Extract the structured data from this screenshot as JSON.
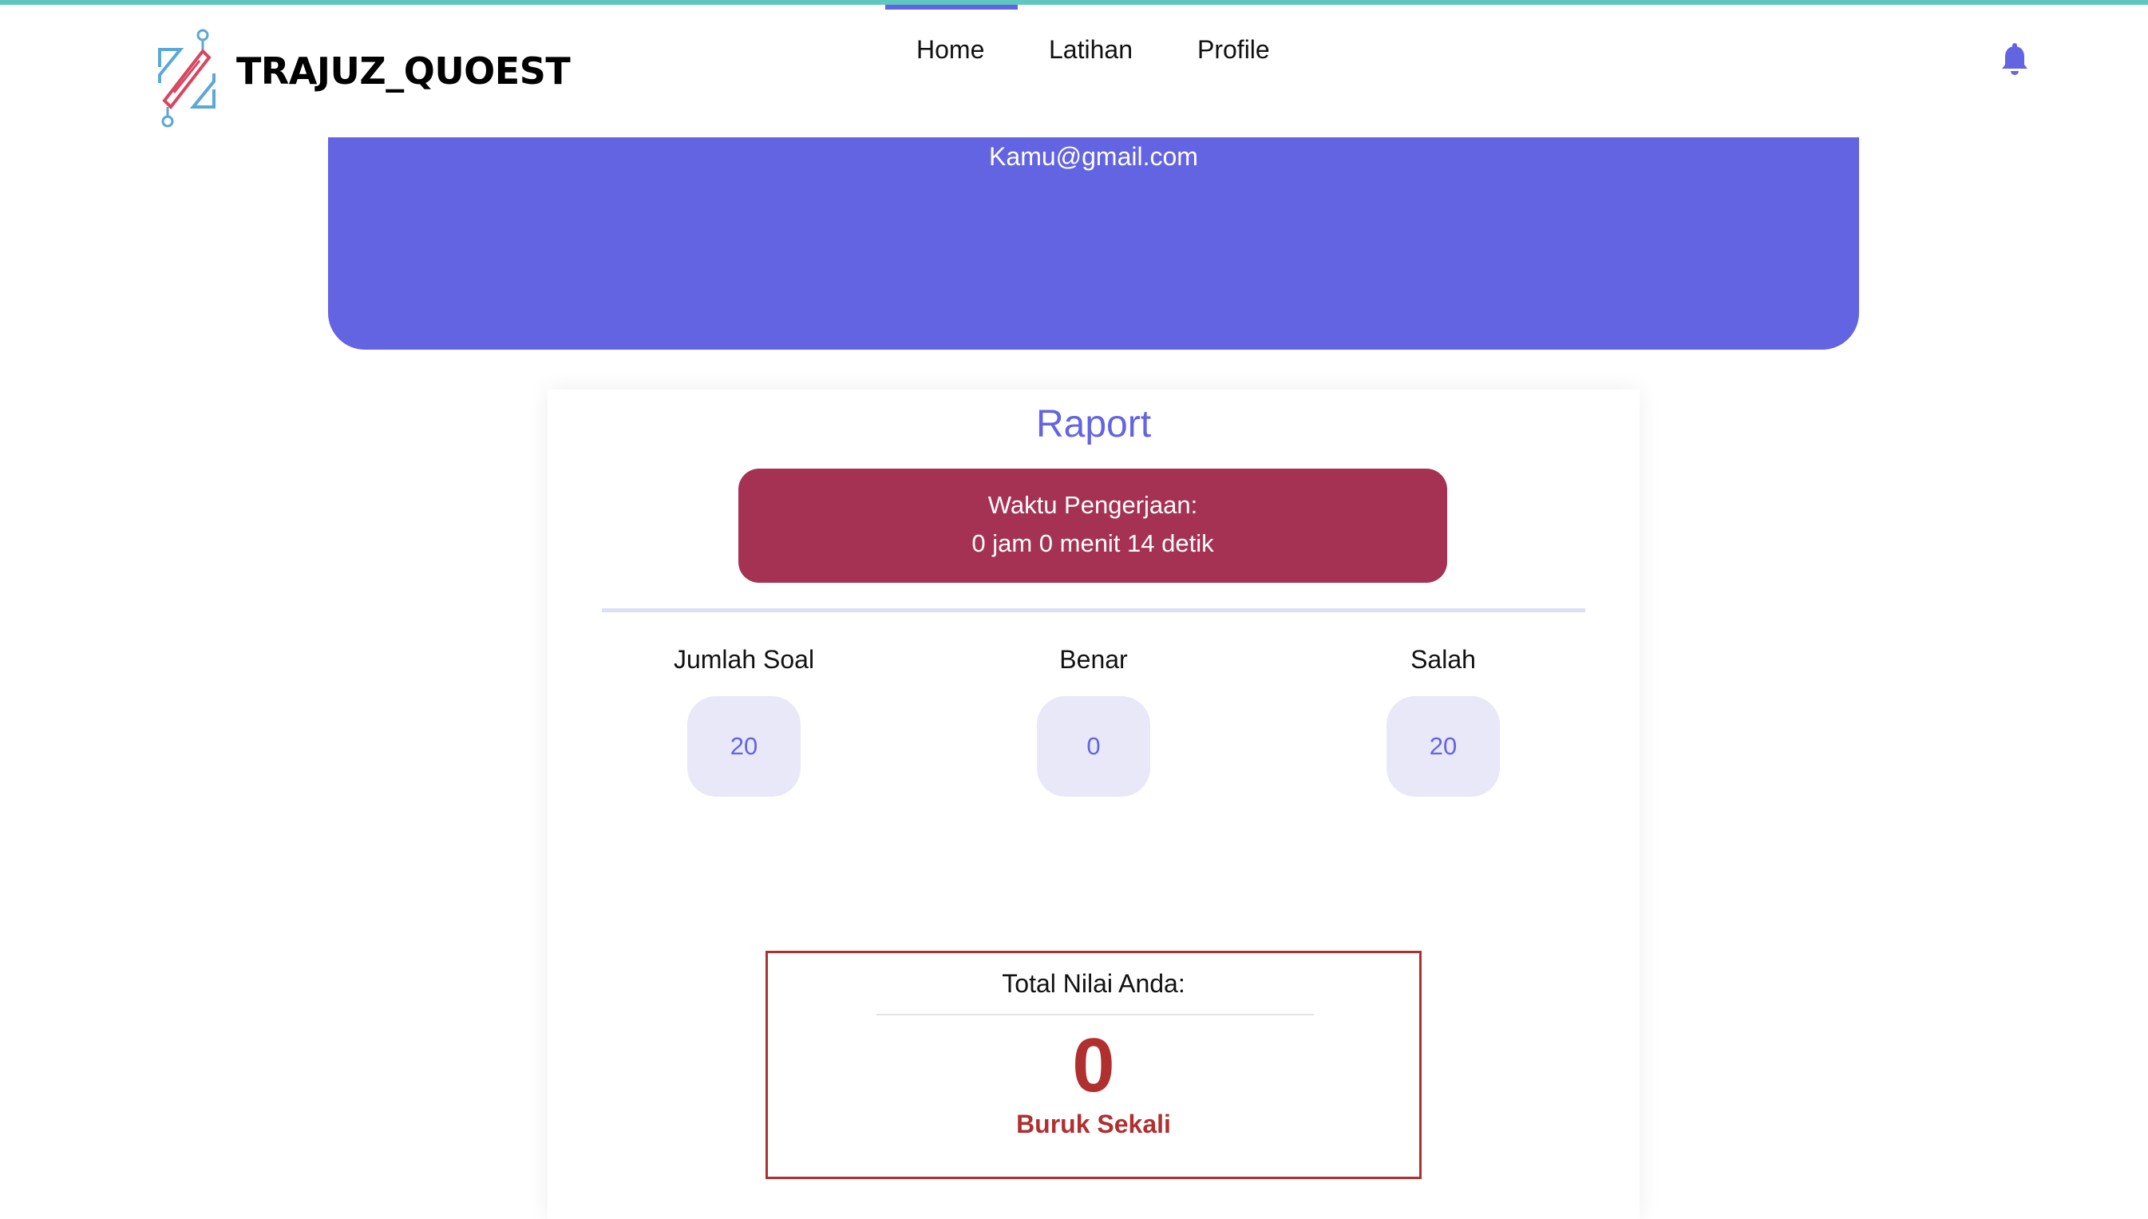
{
  "app": {
    "brand": "TRAJUZ_QUOEST",
    "accent_color": "#6264e1"
  },
  "nav": {
    "items": [
      "Home",
      "Latihan",
      "Profile"
    ],
    "active": "Home",
    "notification_icon": "bell-icon"
  },
  "profile": {
    "email": "Kamu@gmail.com"
  },
  "report": {
    "title": "Raport",
    "time_label": "Waktu Pengerjaan:",
    "time_value": "0 jam 0 menit 14 detik",
    "stats": {
      "total_label": "Jumlah Soal",
      "total_value": "20",
      "correct_label": "Benar",
      "correct_value": "0",
      "wrong_label": "Salah",
      "wrong_value": "20"
    },
    "score_label": "Total Nilai Anda:",
    "score_value": "0",
    "score_grade": "Buruk Sekali",
    "time_box_color": "#a53253",
    "score_color": "#b03030"
  }
}
